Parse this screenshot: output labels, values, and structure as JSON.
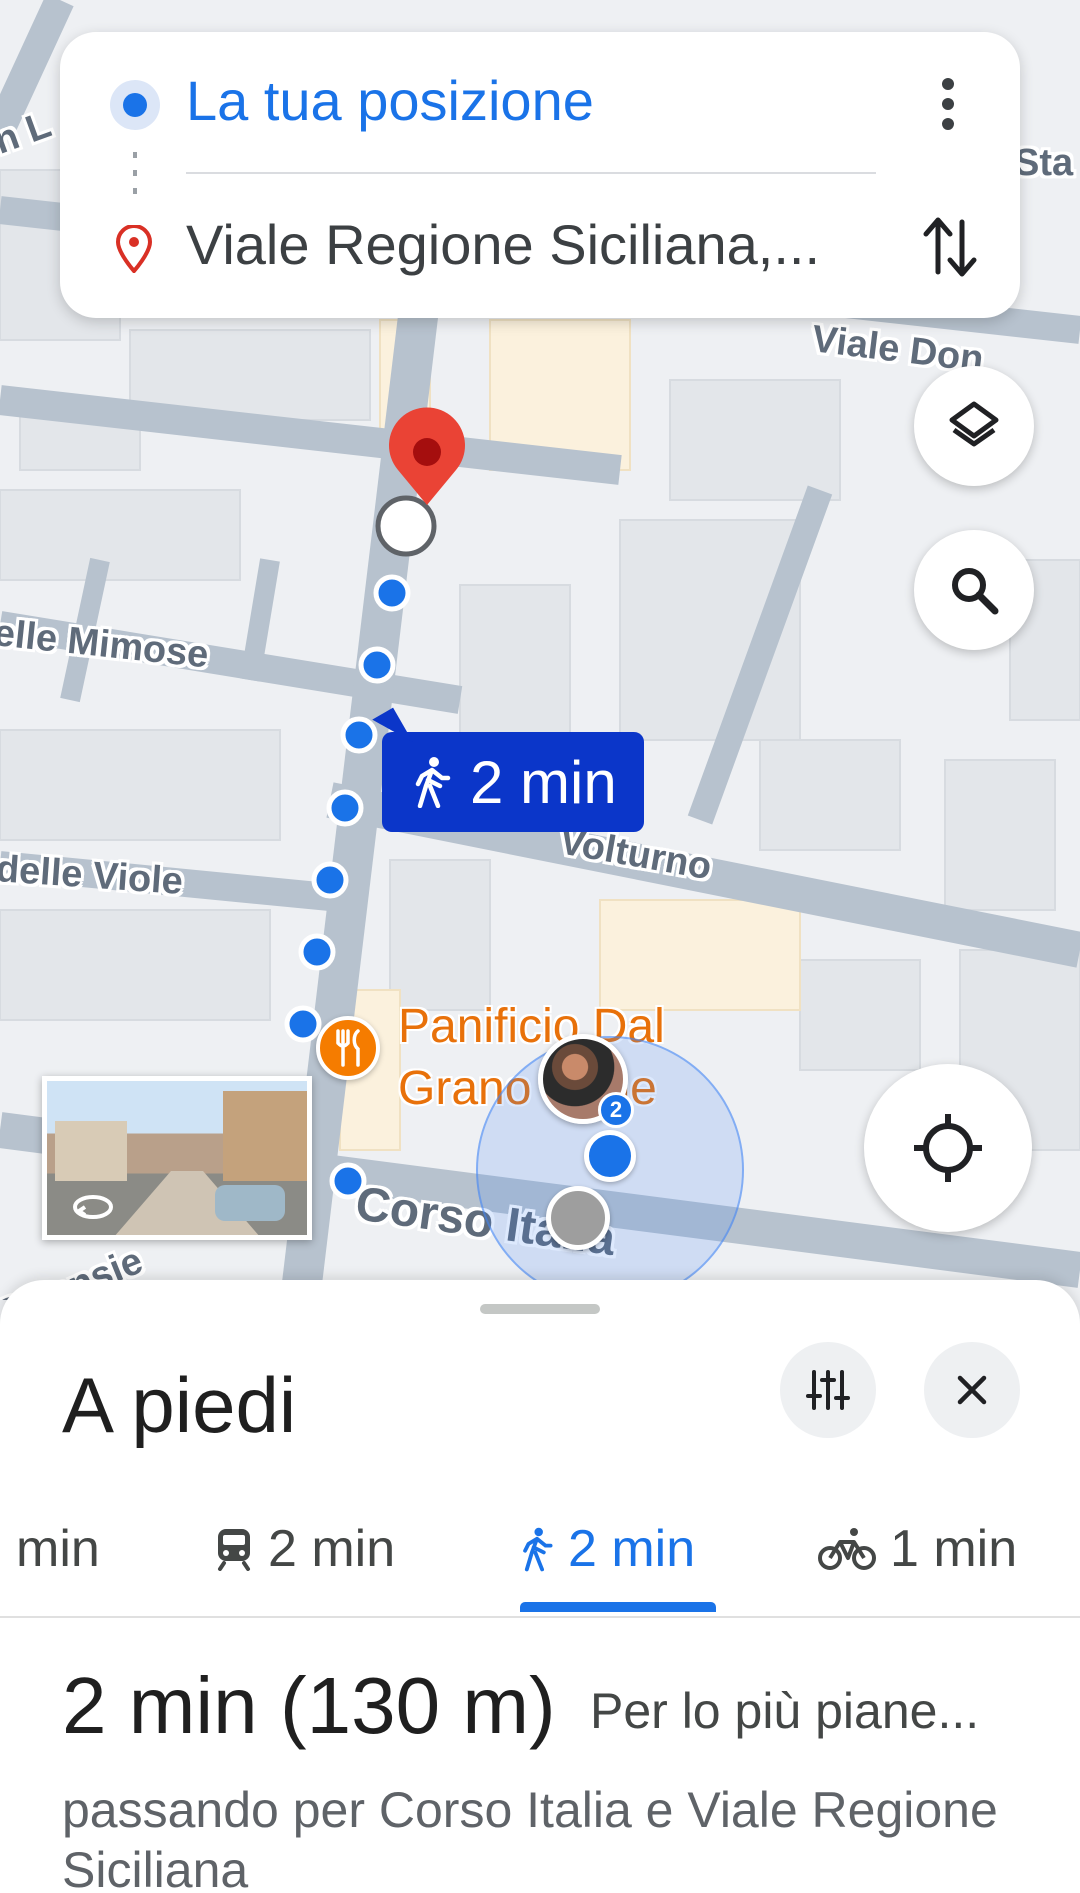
{
  "route_card": {
    "origin": "La tua posizione",
    "destination": "Viale Regione Siciliana,..."
  },
  "map": {
    "street_labels": {
      "viale_don": "Viale Don",
      "mimose": "elle Mimose",
      "viole": "delle Viole",
      "volturno": "Volturno",
      "corso_italia": "Corso Italia",
      "sta": "Sta",
      "ortensie": "Ortensie",
      "edge_n": "n L"
    },
    "travel_bubble": {
      "icon": "walk-icon",
      "time": "2 min"
    },
    "poi": {
      "name": "Panificio Dal Grano Pane",
      "icon": "restaurant-icon"
    },
    "avatar_badge": "2",
    "colors": {
      "route": "#1a73e8",
      "bubble": "#0b36c9",
      "poi": "#e8710a",
      "pin": "#ea4335"
    }
  },
  "sheet": {
    "title": "A piedi",
    "tabs": [
      {
        "label": "min",
        "icon": "car-icon"
      },
      {
        "label": "2 min",
        "icon": "train-icon"
      },
      {
        "label": "2 min",
        "icon": "walk-icon",
        "active": true
      },
      {
        "label": "1 min",
        "icon": "bike-icon"
      }
    ],
    "summary": {
      "duration": "2 min",
      "distance": "(130 m)",
      "terrain": "Per lo più piane...",
      "via": "passando per Corso Italia e Viale Regione Siciliana"
    }
  }
}
